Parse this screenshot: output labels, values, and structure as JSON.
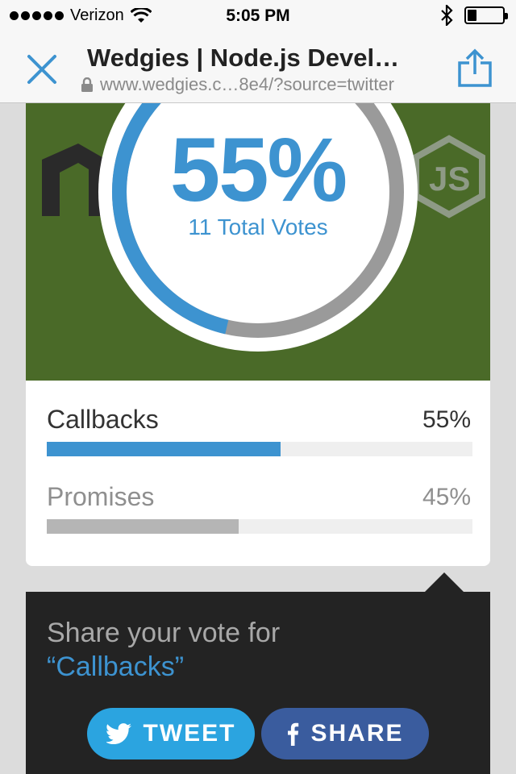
{
  "status_bar": {
    "carrier": "Verizon",
    "time": "5:05 PM",
    "battery_level": 0.25
  },
  "navbar": {
    "title": "Wedgies | Node.js Devel…",
    "url": "www.wedgies.c…8e4/?source=twitter"
  },
  "poll": {
    "headline_percent": "55%",
    "headline_fraction": 0.55,
    "total_votes_text": "11 Total Votes",
    "options": [
      {
        "label": "Callbacks",
        "percent_text": "55%",
        "fraction": 0.55,
        "color": "#3d93d0",
        "label_color": "#333333"
      },
      {
        "label": "Promises",
        "percent_text": "45%",
        "fraction": 0.45,
        "color": "#b5b5b5",
        "label_color": "#8f8f8f"
      }
    ]
  },
  "share": {
    "prompt": "Share your vote for",
    "choice": "“Callbacks”",
    "tweet_label": "TWEET",
    "share_label": "SHARE"
  },
  "colors": {
    "accent": "#3d93d0",
    "hero_bg": "#4a6a28",
    "twitter": "#2ba4e0",
    "facebook": "#3a5c9e"
  }
}
